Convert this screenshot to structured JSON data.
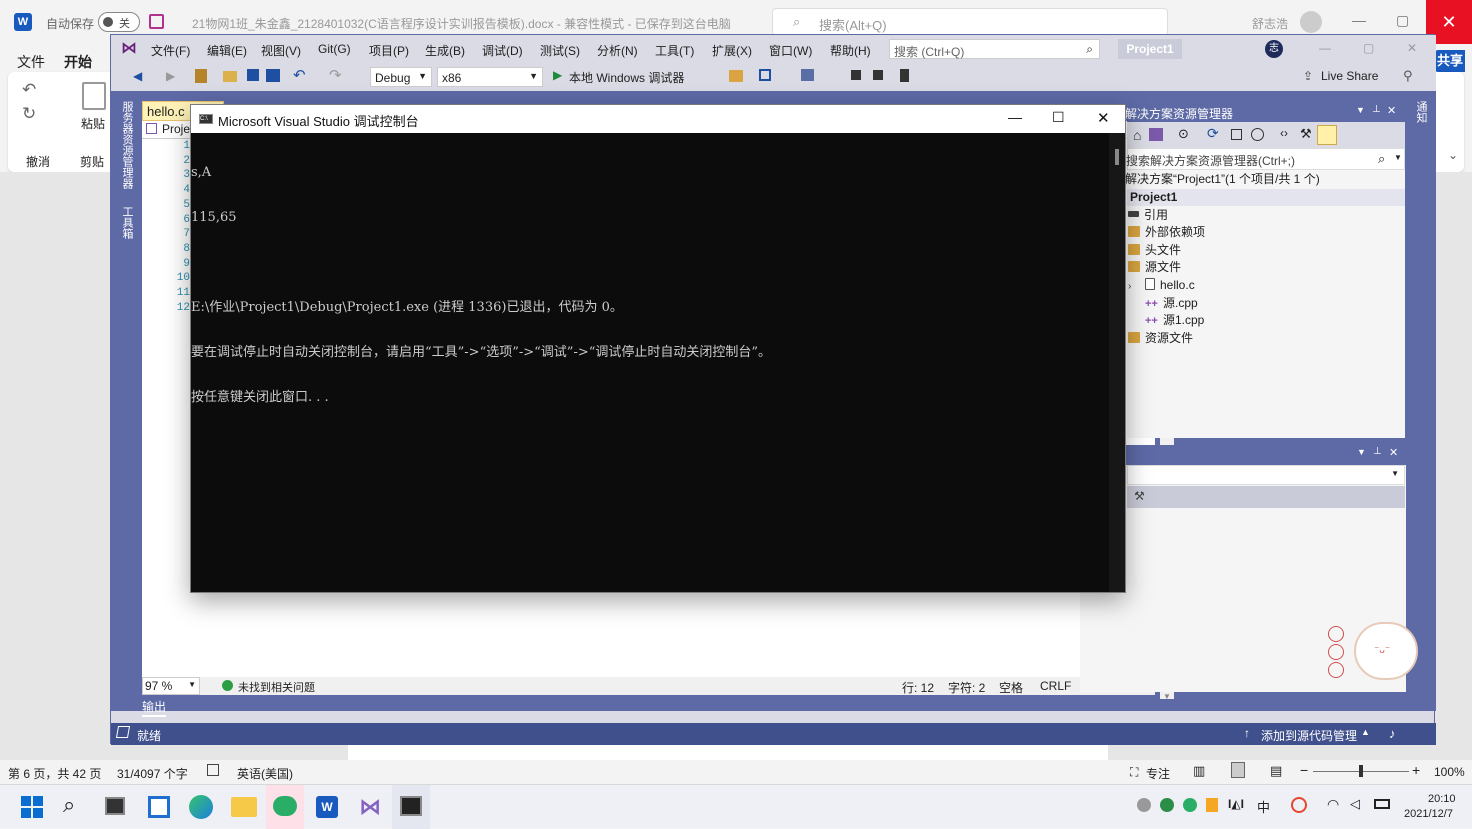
{
  "word": {
    "autosave_label": "自动保存",
    "autosave_state": "关",
    "doc_title": "21物网1班_朱金鑫_2128401032(C语言程序设计实训报告模板).docx  -  兼容性模式  -  已保存到这台电脑",
    "search_placeholder": "搜索(Alt+Q)",
    "user_name": "舒志浩",
    "tabs": {
      "file": "文件",
      "home": "开始"
    },
    "ribbon": {
      "undo": "撤消",
      "paste": "粘贴",
      "clipboard": "剪贴"
    },
    "share": "共享",
    "status": {
      "page": "第 6 页，共 42 页",
      "words": "31/4097 个字",
      "language": "英语(美国)",
      "focus": "专注",
      "zoom": "100%"
    }
  },
  "vs": {
    "menu": [
      "文件(F)",
      "编辑(E)",
      "视图(V)",
      "Git(G)",
      "项目(P)",
      "生成(B)",
      "调试(D)",
      "测试(S)",
      "分析(N)",
      "工具(T)",
      "扩展(X)",
      "窗口(W)",
      "帮助(H)"
    ],
    "search_placeholder": "搜索 (Ctrl+Q)",
    "project_name": "Project1",
    "avatar_initial": "志",
    "config": "Debug",
    "platform": "x86",
    "run_label": "本地 Windows 调试器",
    "live_share": "Live Share",
    "side_tabs": [
      "服务器资源管理器",
      "工具箱"
    ],
    "right_side_tab": "通知",
    "doc_tab": "hello.c",
    "nav_project": "Proje",
    "line_numbers": [
      "1",
      "2",
      "3",
      "4",
      "5",
      "6",
      "7",
      "8",
      "9",
      "10",
      "11",
      "12"
    ],
    "editor_status": {
      "zoom": "97 %",
      "issues": "未找到相关问题",
      "line": "行: 12",
      "char": "字符: 2",
      "spaces": "空格",
      "eol": "CRLF"
    },
    "output_tab": "输出",
    "status": {
      "ready": "就绪",
      "source_control": "添加到源代码管理"
    }
  },
  "console": {
    "title": "Microsoft Visual Studio 调试控制台",
    "lines": [
      "s,A",
      "115,65",
      "",
      "E:\\作业\\Project1\\Debug\\Project1.exe (进程 1336)已退出，代码为 0。",
      "要在调试停止时自动关闭控制台，请启用“工具”->“选项”->“调试”->“调试停止时自动关闭控制台”。",
      "按任意键关闭此窗口. . ."
    ]
  },
  "solution_explorer": {
    "title": "解决方案资源管理器",
    "search_placeholder": "搜索解决方案资源管理器(Ctrl+;)",
    "items": [
      {
        "label": "解决方案“Project1”(1 个项目/共 1 个)",
        "indent": 0
      },
      {
        "label": "Project1",
        "indent": 1
      },
      {
        "label": "引用",
        "indent": 2
      },
      {
        "label": "外部依赖项",
        "indent": 2
      },
      {
        "label": "头文件",
        "indent": 2
      },
      {
        "label": "源文件",
        "indent": 2
      },
      {
        "label": "hello.c",
        "indent": 3
      },
      {
        "label": "源.cpp",
        "indent": 3
      },
      {
        "label": "源1.cpp",
        "indent": 3
      },
      {
        "label": "资源文件",
        "indent": 2
      }
    ]
  },
  "taskbar": {
    "time": "20:10",
    "date": "2021/12/7"
  },
  "colors": {
    "vs_accent": "#5d6aa6",
    "vs_status": "#40508d",
    "word_blue": "#185abd",
    "console_bg": "#0c0c0c"
  }
}
